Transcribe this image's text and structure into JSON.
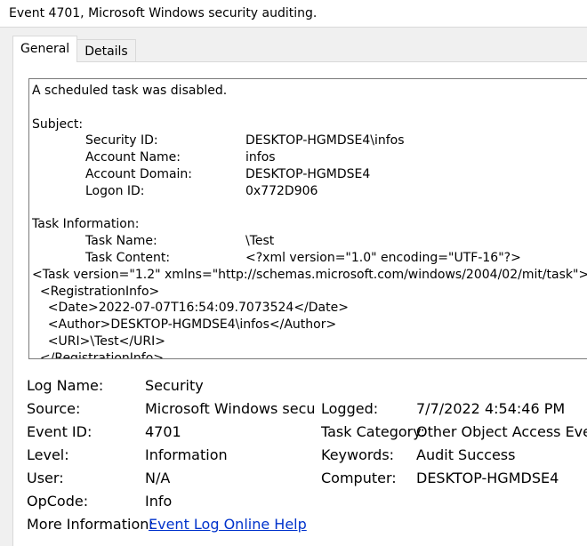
{
  "window": {
    "title": "Event 4701, Microsoft Windows security auditing."
  },
  "tabs": [
    {
      "label": "General",
      "active": true
    },
    {
      "label": "Details",
      "active": false
    }
  ],
  "description": {
    "summary": "A scheduled task was disabled.",
    "subject_heading": "Subject:",
    "subject": [
      {
        "key": "Security ID:",
        "value": "DESKTOP-HGMDSE4\\infos"
      },
      {
        "key": "Account Name:",
        "value": "infos"
      },
      {
        "key": "Account Domain:",
        "value": "DESKTOP-HGMDSE4"
      },
      {
        "key": "Logon ID:",
        "value": "0x772D906"
      }
    ],
    "task_heading": "Task Information:",
    "task": [
      {
        "key": "Task Name:",
        "value": "\\Test"
      },
      {
        "key": "Task Content:",
        "value": "<?xml version=\"1.0\" encoding=\"UTF-16\"?>"
      }
    ],
    "xml_lines": [
      "<Task version=\"1.2\" xmlns=\"http://schemas.microsoft.com/windows/2004/02/mit/task\">",
      "  <RegistrationInfo>",
      "    <Date>2022-07-07T16:54:09.7073524</Date>",
      "    <Author>DESKTOP-HGMDSE4\\infos</Author>",
      "    <URI>\\Test</URI>",
      "  </RegistrationInfo>"
    ]
  },
  "fields": {
    "log_name_label": "Log Name:",
    "log_name": "Security",
    "source_label": "Source:",
    "source": "Microsoft Windows security auditing.",
    "event_id_label": "Event ID:",
    "event_id": "4701",
    "level_label": "Level:",
    "level": "Information",
    "user_label": "User:",
    "user": "N/A",
    "opcode_label": "OpCode:",
    "opcode": "Info",
    "more_info_label": "More Information:",
    "more_info_link": "Event Log Online Help",
    "logged_label": "Logged:",
    "logged": "7/7/2022 4:54:46 PM",
    "task_category_label": "Task Category:",
    "task_category": "Other Object Access Events",
    "keywords_label": "Keywords:",
    "keywords": "Audit Success",
    "computer_label": "Computer:",
    "computer": "DESKTOP-HGMDSE4"
  },
  "colors": {
    "link": "#0033cc",
    "background": "#f0f0f0",
    "panel": "#ffffff"
  }
}
